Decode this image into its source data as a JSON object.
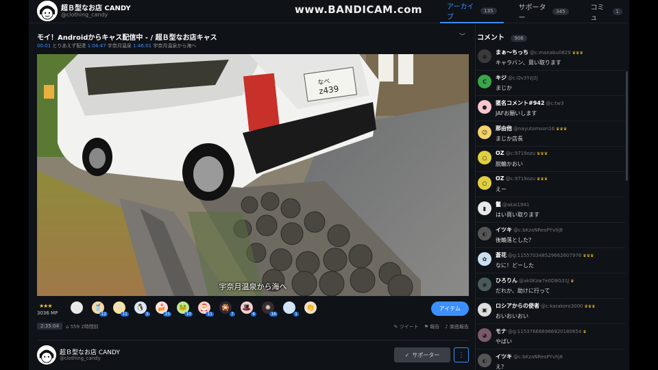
{
  "watermark": "www.BANDICAM.com",
  "header": {
    "channel_name": "超Ｂ型なお店 CANDY",
    "channel_id": "@clothing_candy",
    "tabs": [
      {
        "label": "アーカイブ",
        "count": "135"
      },
      {
        "label": "サポーター",
        "count": "345"
      },
      {
        "label": "コミュ",
        "count": "1"
      }
    ]
  },
  "video": {
    "title": "モイ！Androidからキャス配信中 - / 超Ｂ型なお店キャス",
    "chapters": [
      {
        "time": "00:01",
        "label": "とりあえず配達"
      },
      {
        "time": "1:04:47",
        "label": "宇奈月温泉"
      },
      {
        "time": "1:46:01",
        "label": "宇奈月温泉から海へ"
      }
    ],
    "subtitle": "宇奈月温泉から海へ",
    "plate": "なべ\nz439"
  },
  "itembar": {
    "stars": "★★★",
    "mp": "3036 MP",
    "items": [
      {
        "icon": "egg-icon",
        "glyph": "⬭",
        "count": "",
        "bg": "#e8e8e8"
      },
      {
        "icon": "drink-icon",
        "glyph": "🥤",
        "count": "12",
        "bg": "#f5d9a8"
      },
      {
        "icon": "cat-icon",
        "glyph": "🐱",
        "count": "11",
        "bg": "#f7e3a0"
      },
      {
        "icon": "penguin-icon",
        "glyph": "🐧",
        "count": "5",
        "bg": "#d8e8ff"
      },
      {
        "icon": "cake-icon",
        "glyph": "🍰",
        "count": "15",
        "bg": "#fde2e2"
      },
      {
        "icon": "frog-icon",
        "glyph": "🐸",
        "count": "10",
        "bg": "#bfe6a0"
      },
      {
        "icon": "santa-icon",
        "glyph": "🎅",
        "count": "11",
        "bg": "#f9d0d0"
      },
      {
        "icon": "firework-icon",
        "glyph": "🎇",
        "count": "7",
        "bg": "#2a2a3a"
      },
      {
        "icon": "hat-icon",
        "glyph": "🎩",
        "count": "4",
        "bg": "#f5cccc"
      },
      {
        "icon": "sparkler-icon",
        "glyph": "✺",
        "count": "16",
        "bg": "#3a2a2a"
      },
      {
        "icon": "character-icon",
        "glyph": "☺",
        "count": "1",
        "bg": "#cfe5ff"
      },
      {
        "icon": "clap-icon",
        "glyph": "👏",
        "count": "",
        "bg": "#f5e0c8"
      }
    ],
    "item_button": "アイテム"
  },
  "meta": {
    "duration": "2:35:04",
    "views": "559  2時間前",
    "tweet": "ツイート",
    "report": "報告",
    "song_report": "楽曲報告"
  },
  "owner": {
    "name": "超Ｂ型なお店 CANDY",
    "id": "@clothing_candy",
    "supporter_button": "サポーター"
  },
  "comments": {
    "title": "コメント",
    "count": "906",
    "items": [
      {
        "name": "まぁ～ちっち",
        "id": "@c:manabu0829",
        "crown": "♛♛♛",
        "text": "キャラバン、買い取ります",
        "avatar_bg": "#3a3a3a",
        "avatar_glyph": "●"
      },
      {
        "name": "キジ",
        "id": "@c:Qv3YzJ2j",
        "crown": "",
        "text": "まじか",
        "avatar_bg": "#3aa64a",
        "avatar_glyph": "C"
      },
      {
        "name": "匿名コメント#942",
        "id": "@c:tw3",
        "crown": "",
        "text": "JAFお願いします",
        "avatar_bg": "#f7c6cf",
        "avatar_glyph": "●"
      },
      {
        "name": "那由他",
        "id": "@nayutamoon16",
        "crown": "♛♛♛",
        "text": "まじか店長",
        "avatar_bg": "#f3d26a",
        "avatar_glyph": "☺"
      },
      {
        "name": "OZ",
        "id": "@c:9719ozu",
        "crown": "♛♛♛",
        "text": "脱輪かおい",
        "avatar_bg": "#e0d040",
        "avatar_glyph": "○"
      },
      {
        "name": "OZ",
        "id": "@c:9719ozu",
        "crown": "♛♛♛",
        "text": "えー",
        "avatar_bg": "#e0d040",
        "avatar_glyph": "○"
      },
      {
        "name": "鬣",
        "id": "@akai1941",
        "crown": "",
        "text": "はい買い取ります",
        "avatar_bg": "#e8e8e8",
        "avatar_glyph": "▮"
      },
      {
        "name": "イツキ",
        "id": "@c:bKzaNReoPYvhj8",
        "crown": "",
        "text": "後輪落とした？",
        "avatar_bg": "#555555",
        "avatar_glyph": "◐"
      },
      {
        "name": "蒼花",
        "id": "@g:115570348529662607976",
        "crown": "♛♛♛",
        "text": "なに！どーした",
        "avatar_bg": "#c8e0f0",
        "avatar_glyph": "✿"
      },
      {
        "name": "ひろりん",
        "id": "@ak0Kzw7e0D8G31J",
        "crown": "♛",
        "text": "だれか、助けに行って",
        "avatar_bg": "#4a5a5a",
        "avatar_glyph": "◉"
      },
      {
        "name": "ロシアからの使者",
        "id": "@c:karakoro3000",
        "crown": "♛♛♛",
        "text": "おいおいおい",
        "avatar_bg": "#ddd",
        "avatar_glyph": "▣"
      },
      {
        "name": "モナ",
        "id": "@g:115376666966920180654",
        "crown": "♛",
        "text": "やばい",
        "avatar_bg": "#7a5a6a",
        "avatar_glyph": "◕"
      },
      {
        "name": "イツキ",
        "id": "@c:bKzaNReoPYvhj8",
        "crown": "",
        "text": "え？",
        "avatar_bg": "#555555",
        "avatar_glyph": "◐"
      }
    ]
  }
}
